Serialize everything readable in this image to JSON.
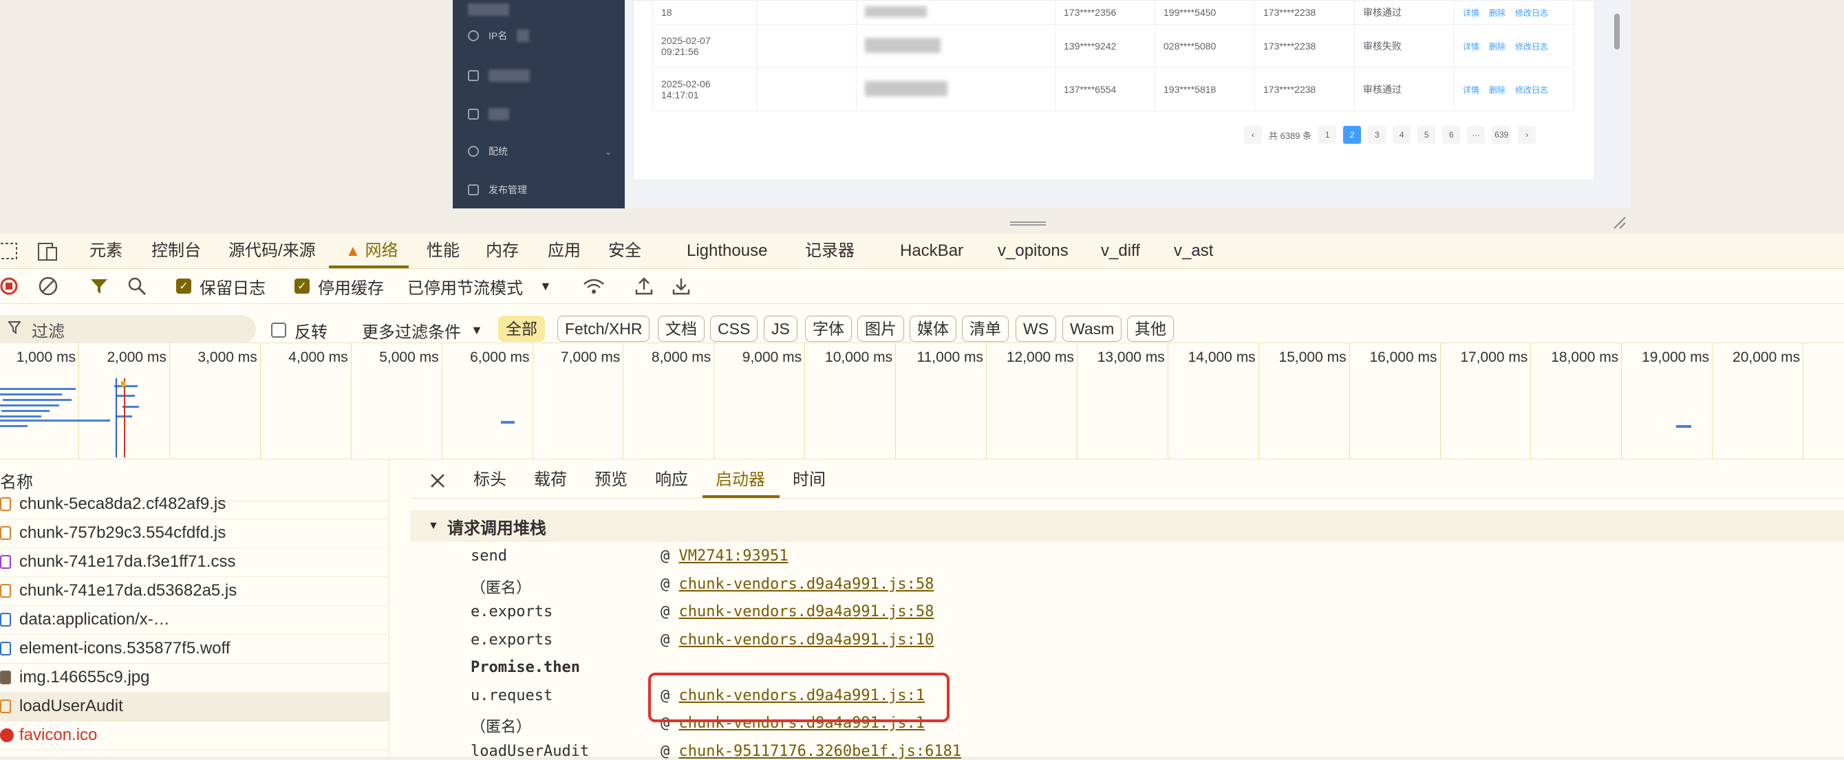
{
  "side_nav": {
    "items": [
      {
        "icon": "info-icon",
        "label": "IP名"
      },
      {
        "icon": "document-icon",
        "label": ""
      },
      {
        "icon": "image-icon",
        "label": ""
      },
      {
        "icon": "clock-icon",
        "label": "配统"
      },
      {
        "icon": "share-icon",
        "label": "发布管理"
      }
    ]
  },
  "table": {
    "rows": [
      {
        "time": "18",
        "c1": "",
        "c2": "",
        "phone1": "173****2356",
        "phone2": "199****5450",
        "phone3": "173****2238",
        "status": "审核通过",
        "actions": [
          "详情",
          "删除",
          "修改日志"
        ]
      },
      {
        "time": "2025-02-07 09:21:56",
        "c1": "",
        "c2": "",
        "phone1": "139****9242",
        "phone2": "028****5080",
        "phone3": "173****2238",
        "status": "审核失败",
        "actions": [
          "详情",
          "删除",
          "修改日志"
        ]
      },
      {
        "time": "2025-02-06 14:17:01",
        "c1": "",
        "c2": "",
        "phone1": "137****6554",
        "phone2": "193****5818",
        "phone3": "173****2238",
        "status": "审核通过",
        "actions": [
          "详情",
          "删除",
          "修改日志"
        ]
      }
    ]
  },
  "pager": {
    "prev": "‹",
    "total": "共 6389 条",
    "pages": [
      "1",
      "2",
      "3",
      "4",
      "5",
      "6",
      "···",
      "639"
    ],
    "active_page": "2",
    "next": "›"
  },
  "devtools": {
    "tabs": [
      "元素",
      "控制台",
      "源代码/来源",
      "网络",
      "性能",
      "内存",
      "应用",
      "安全",
      "Lighthouse",
      "记录器",
      "HackBar",
      "v_opitons",
      "v_diff",
      "v_ast"
    ],
    "active_tab": "网络",
    "toolbar": {
      "preserve_log": "保留日志",
      "disable_cache": "停用缓存",
      "throttling": "已停用节流模式"
    },
    "filter": {
      "placeholder": "过滤",
      "invert": "反转",
      "more_filters": "更多过滤条件",
      "types": [
        "全部",
        "Fetch/XHR",
        "文档",
        "CSS",
        "JS",
        "字体",
        "图片",
        "媒体",
        "清单",
        "WS",
        "Wasm",
        "其他"
      ]
    },
    "timeline_ticks": [
      "1,000 ms",
      "2,000 ms",
      "3,000 ms",
      "4,000 ms",
      "5,000 ms",
      "6,000 ms",
      "7,000 ms",
      "8,000 ms",
      "9,000 ms",
      "10,000 ms",
      "11,000 ms",
      "12,000 ms",
      "13,000 ms",
      "14,000 ms",
      "15,000 ms",
      "16,000 ms",
      "17,000 ms",
      "18,000 ms",
      "19,000 ms",
      "20,000 ms",
      "21,0"
    ],
    "name_header": "名称",
    "requests": [
      {
        "name": "chunk-5eca8da2.cf482af9.js",
        "type": "script"
      },
      {
        "name": "chunk-757b29c3.554cfdfd.js",
        "type": "script"
      },
      {
        "name": "chunk-741e17da.f3e1ff71.css",
        "type": "stylesheet"
      },
      {
        "name": "chunk-741e17da.d53682a5.js",
        "type": "script"
      },
      {
        "name": "data:application/x-…",
        "type": "font"
      },
      {
        "name": "element-icons.535877f5.woff",
        "type": "font"
      },
      {
        "name": "img.146655c9.jpg",
        "type": "image"
      },
      {
        "name": "loadUserAudit",
        "type": "xhr"
      },
      {
        "name": "favicon.ico",
        "type": "error"
      }
    ],
    "detail_tabs": [
      "标头",
      "载荷",
      "预览",
      "响应",
      "启动器",
      "时间"
    ],
    "active_detail_tab": "启动器",
    "stack_title": "请求调用堆栈",
    "stack": [
      {
        "fn": "send",
        "at": "VM2741:93951"
      },
      {
        "fn": "（匿名）",
        "at": "chunk-vendors.d9a4a991.js:58"
      },
      {
        "fn": "e.exports",
        "at": "chunk-vendors.d9a4a991.js:58"
      },
      {
        "fn": "e.exports",
        "at": "chunk-vendors.d9a4a991.js:10"
      },
      {
        "fn": "Promise.then",
        "at": ""
      },
      {
        "fn": "u.request",
        "at": "chunk-vendors.d9a4a991.js:1"
      },
      {
        "fn": "（匿名）",
        "at": "chunk-vendors.d9a4a991.js:1"
      },
      {
        "fn": "loadUserAudit",
        "at": "chunk-95117176.3260be1f.js:6181"
      }
    ]
  },
  "colors": {
    "accent": "#8a6a00",
    "nav_bg": "#2f3b4e",
    "link": "#409eff",
    "highlight_border": "#e0332a",
    "error": "#d93025"
  }
}
